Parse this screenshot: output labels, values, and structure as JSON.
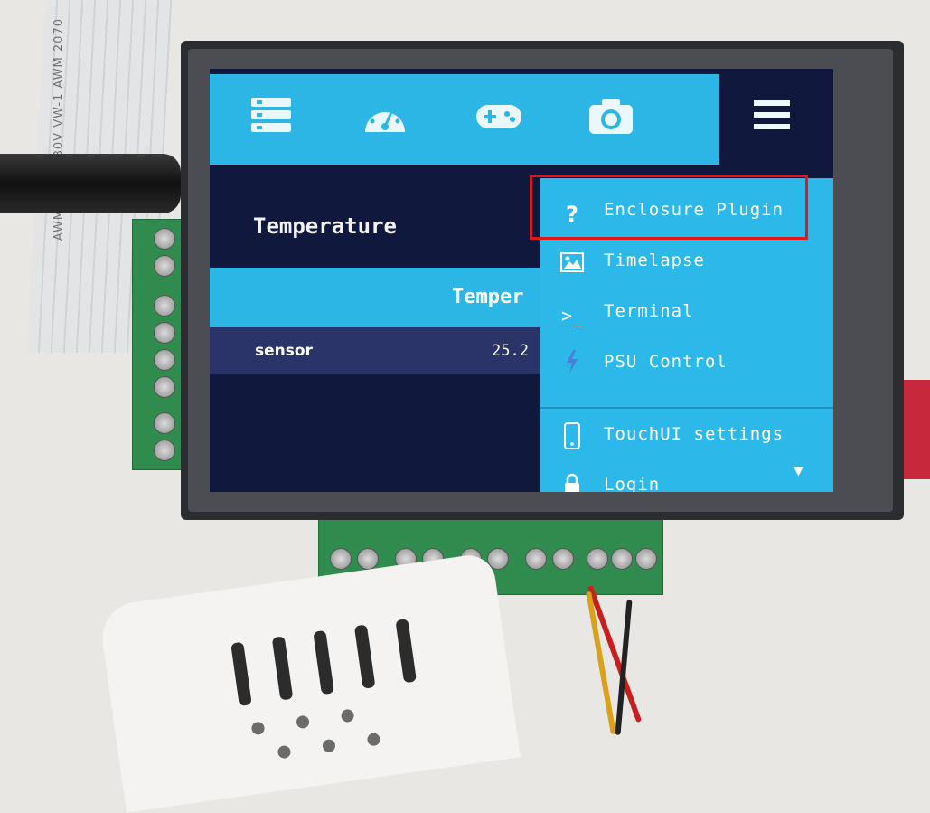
{
  "ribbon_text": "AWM 20706 80V VW-1 AWM 2070",
  "topbar": {
    "icons": [
      "files-icon",
      "dashboard-gauge-icon",
      "gamepad-icon",
      "camera-icon"
    ],
    "menu_icon": "hamburger-menu-icon"
  },
  "page": {
    "title": "Temperature",
    "band_text": "Temper",
    "sensor_label": "sensor",
    "sensor_value": "25.2"
  },
  "dropdown": {
    "items": [
      {
        "icon": "question-icon",
        "label": "Enclosure Plugin"
      },
      {
        "icon": "image-icon",
        "label": "Timelapse"
      },
      {
        "icon": "terminal-icon",
        "label": "Terminal"
      },
      {
        "icon": "lightning-icon",
        "label": "PSU Control"
      },
      {
        "icon": "phone-icon",
        "label": "TouchUI settings"
      },
      {
        "icon": "lock-icon",
        "label": "Login"
      }
    ]
  },
  "colors": {
    "accent": "#2bb6e6",
    "screen_bg": "#10183d",
    "highlight": "#e01818"
  }
}
